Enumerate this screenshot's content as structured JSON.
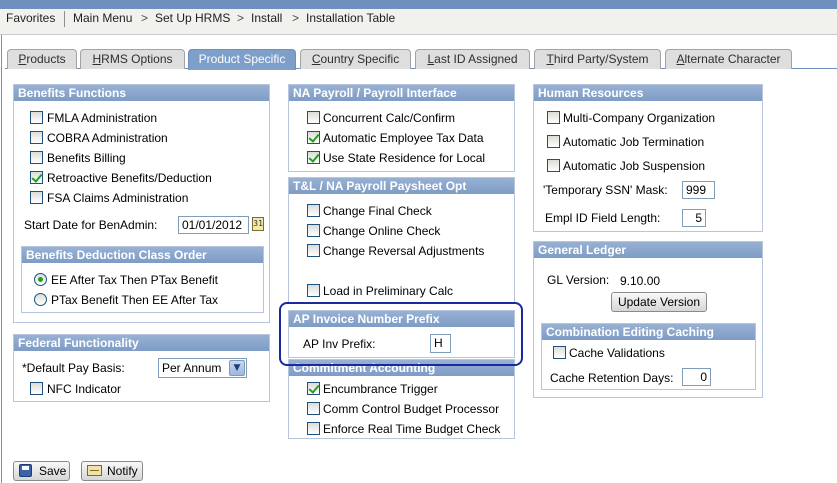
{
  "nav": {
    "favorites": "Favorites",
    "main_menu": "Main Menu",
    "crumbs": [
      "Set Up HRMS",
      "Install",
      "Installation Table"
    ],
    "arrow": ">"
  },
  "tabs": [
    {
      "pre": "",
      "ul": "P",
      "post": "roducts"
    },
    {
      "pre": "",
      "ul": "H",
      "post": "RMS Options"
    },
    {
      "pre": "Product Specific",
      "ul": "",
      "post": ""
    },
    {
      "pre": "",
      "ul": "C",
      "post": "ountry Specific"
    },
    {
      "pre": "",
      "ul": "L",
      "post": "ast ID Assigned"
    },
    {
      "pre": "",
      "ul": "T",
      "post": "hird Party/System"
    },
    {
      "pre": "",
      "ul": "A",
      "post": "lternate Character"
    }
  ],
  "benefits": {
    "title": "Benefits Functions",
    "items": [
      {
        "label": "FMLA Administration",
        "checked": false
      },
      {
        "label": "COBRA Administration",
        "checked": false
      },
      {
        "label": "Benefits Billing",
        "checked": false
      },
      {
        "label": "Retroactive Benefits/Deduction",
        "checked": true
      },
      {
        "label": "FSA Claims Administration",
        "checked": false
      }
    ],
    "start_date_label": "Start Date for BenAdmin:",
    "start_date_value": "01/01/2012",
    "calendar_glyph": "31",
    "class_order": {
      "title": "Benefits Deduction Class Order",
      "options": [
        {
          "label": "EE After Tax Then PTax Benefit",
          "selected": true
        },
        {
          "label": "PTax Benefit Then EE After Tax",
          "selected": false
        }
      ]
    }
  },
  "federal": {
    "title": "Federal Functionality",
    "pay_basis_label": "*Default Pay Basis:",
    "pay_basis_value": "Per Annum",
    "nfc_label": "NFC Indicator",
    "nfc_checked": false
  },
  "na_payroll": {
    "title": "NA Payroll / Payroll Interface",
    "items": [
      {
        "label": "Concurrent Calc/Confirm",
        "checked": false
      },
      {
        "label": "Automatic Employee Tax Data",
        "checked": true
      },
      {
        "label": "Use State Residence for Local",
        "checked": true
      }
    ]
  },
  "tl_paysheet": {
    "title": "T&L / NA Payroll Paysheet Opt",
    "items": [
      {
        "label": "Change Final Check",
        "checked": false
      },
      {
        "label": "Change Online Check",
        "checked": false
      },
      {
        "label": "Change Reversal Adjustments",
        "checked": false
      },
      {
        "label": "Load in Preliminary Calc",
        "checked": false
      }
    ]
  },
  "ap_invoice": {
    "title": "AP Invoice Number Prefix",
    "prefix_label": "AP Inv Prefix:",
    "prefix_value": "H"
  },
  "commitment": {
    "title": "Commitment Accounting",
    "items": [
      {
        "label": "Encumbrance Trigger",
        "checked": true
      },
      {
        "label": "Comm Control Budget Processor",
        "checked": false
      },
      {
        "label": "Enforce Real Time Budget Check",
        "checked": false
      }
    ]
  },
  "hr": {
    "title": "Human Resources",
    "items": [
      {
        "label": "Multi-Company Organization",
        "checked": false
      },
      {
        "label": "Automatic Job Termination",
        "checked": false
      },
      {
        "label": "Automatic Job Suspension",
        "checked": false
      }
    ],
    "ssn_mask_label": "'Temporary SSN' Mask:",
    "ssn_mask_value": "999",
    "empl_id_label": "Empl ID Field Length:",
    "empl_id_value": "5"
  },
  "gl": {
    "title": "General Ledger",
    "version_label": "GL Version:",
    "version_value": "9.10.00",
    "update_button": "Update Version",
    "caching": {
      "title": "Combination Editing Caching",
      "cache_label": "Cache Validations",
      "cache_checked": false,
      "retention_label": "Cache Retention Days:",
      "retention_value": "0"
    }
  },
  "footer": {
    "save": "Save",
    "notify": "Notify"
  }
}
